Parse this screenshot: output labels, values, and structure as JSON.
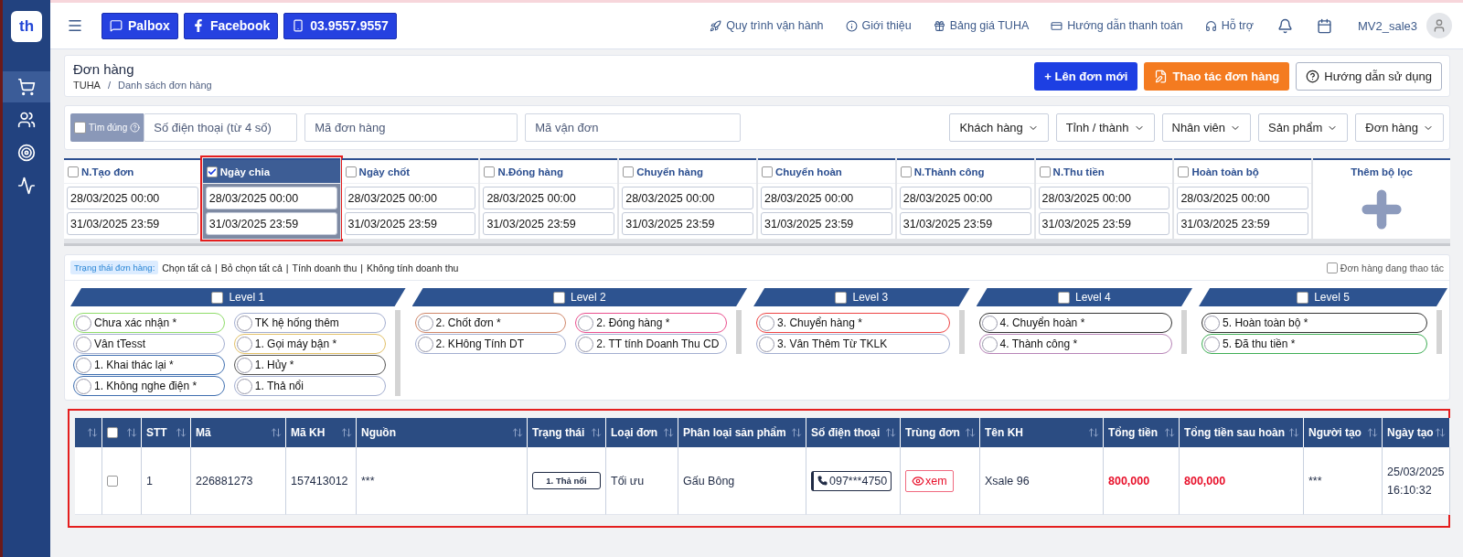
{
  "sidebar": {
    "logo": "th",
    "items": [
      {
        "kind": "cart",
        "selected": true
      },
      {
        "kind": "users",
        "selected": false
      },
      {
        "kind": "target",
        "selected": false
      },
      {
        "kind": "activity",
        "selected": false
      }
    ]
  },
  "topbar": {
    "quick_links": [
      {
        "kind": "chat",
        "label": "Palbox"
      },
      {
        "kind": "facebook",
        "label": "Facebook"
      },
      {
        "kind": "phone",
        "label": "03.9557.9557"
      }
    ],
    "nav": [
      {
        "kind": "rocket",
        "label": "Quy trình vận hành"
      },
      {
        "kind": "info",
        "label": "Giới thiệu"
      },
      {
        "kind": "gift",
        "label": "Bảng giá TUHA"
      },
      {
        "kind": "card",
        "label": "Hướng dẫn thanh toán"
      },
      {
        "kind": "headset",
        "label": "Hỗ trợ"
      }
    ],
    "user": "MV2_sale3"
  },
  "page": {
    "title": "Đơn hàng",
    "breadcrumb": [
      "TUHA",
      "Danh sách đơn hàng"
    ],
    "breadcrumb_separator": "/",
    "actions": [
      {
        "kind": "primary",
        "label": "+ Lên đơn mới"
      },
      {
        "kind": "warning",
        "label": "Thao tác đơn hàng"
      },
      {
        "kind": "help",
        "label": "Hướng dẫn sử dụng"
      }
    ]
  },
  "search": {
    "exact": {
      "label": "Tìm đúng",
      "checked": false
    },
    "fields": [
      {
        "placeholder": "Số điện thoại (từ 4 số)"
      },
      {
        "placeholder": "Mã đơn hàng"
      },
      {
        "placeholder": "Mã vận đơn"
      }
    ],
    "dropdowns": [
      "Khách hàng",
      "Tỉnh / thành",
      "Nhân viên",
      "Sản phẩm",
      "Đơn hàng"
    ]
  },
  "date_filters": [
    {
      "label": "N.Tạo đơn",
      "checked": false,
      "highlighted": false,
      "from": "28/03/2025 00:00",
      "to": "31/03/2025 23:59"
    },
    {
      "label": "Ngày chia",
      "checked": true,
      "highlighted": true,
      "from": "28/03/2025 00:00",
      "to": "31/03/2025 23:59"
    },
    {
      "label": "Ngày chốt",
      "checked": false,
      "highlighted": false,
      "from": "28/03/2025 00:00",
      "to": "31/03/2025 23:59"
    },
    {
      "label": "N.Đóng hàng",
      "checked": false,
      "highlighted": false,
      "from": "28/03/2025 00:00",
      "to": "31/03/2025 23:59"
    },
    {
      "label": "Chuyển hàng",
      "checked": false,
      "highlighted": false,
      "from": "28/03/2025 00:00",
      "to": "31/03/2025 23:59"
    },
    {
      "label": "Chuyển hoàn",
      "checked": false,
      "highlighted": false,
      "from": "28/03/2025 00:00",
      "to": "31/03/2025 23:59"
    },
    {
      "label": "N.Thành công",
      "checked": false,
      "highlighted": false,
      "from": "28/03/2025 00:00",
      "to": "31/03/2025 23:59"
    },
    {
      "label": "N.Thu tiền",
      "checked": false,
      "highlighted": false,
      "from": "28/03/2025 00:00",
      "to": "31/03/2025 23:59"
    },
    {
      "label": "Hoàn toàn bộ",
      "checked": false,
      "highlighted": false,
      "from": "28/03/2025 00:00",
      "to": "31/03/2025 23:59"
    }
  ],
  "add_filter": "Thêm bộ lọc",
  "status": {
    "tag": "Trạng thái đơn hàng:",
    "links": [
      "Chọn tất cả",
      "Bỏ chọn tất cả",
      "Tính doanh thu",
      "Không tính doanh thu"
    ],
    "link_separator": "|",
    "in_progress": {
      "label": "Đơn hàng đang thao tác",
      "checked": false
    },
    "levels": [
      {
        "label": "Level 1",
        "checked": false,
        "items": [
          {
            "label": "Chưa xác nhận *",
            "color": "#8fdc6a",
            "checked": false
          },
          {
            "label": "TK hệ hống thêm",
            "color": "#a3aed0",
            "checked": false
          },
          {
            "label": "Vân tTesst",
            "color": "#a3aed0",
            "checked": false
          },
          {
            "label": "1. Gọi máy bận *",
            "color": "#e2c067",
            "checked": false
          },
          {
            "label": "1. Khai thác lại *",
            "color": "#3f6fb0",
            "checked": false
          },
          {
            "label": "1. Hủy *",
            "color": "#555555",
            "checked": false
          },
          {
            "label": "1. Không nghe điện *",
            "color": "#3f6fb0",
            "checked": false
          },
          {
            "label": "1. Thả nổi",
            "color": "#a3aed0",
            "checked": false
          }
        ]
      },
      {
        "label": "Level 2",
        "checked": false,
        "items": [
          {
            "label": "2. Chốt đơn *",
            "color": "#d0876a",
            "checked": false
          },
          {
            "label": "2. Đóng hàng *",
            "color": "#ea4f8e",
            "checked": false
          },
          {
            "label": "2. KHông Tính DT",
            "color": "#a3aed0",
            "checked": false
          },
          {
            "label": "2. TT tính Doanh Thu CD",
            "color": "#a3aed0",
            "checked": false
          }
        ]
      },
      {
        "label": "Level 3",
        "checked": false,
        "items": [
          {
            "label": "3. Chuyển hàng *",
            "color": "#ee4444",
            "checked": false
          },
          {
            "label": "3. Vân Thêm Từ TKLK",
            "color": "#a3aed0",
            "checked": false
          }
        ]
      },
      {
        "label": "Level 4",
        "checked": false,
        "items": [
          {
            "label": "4. Chuyển hoàn *",
            "color": "#333333",
            "checked": false
          },
          {
            "label": "4. Thành công *",
            "color": "#b784b7",
            "checked": false
          }
        ]
      },
      {
        "label": "Level 5",
        "checked": false,
        "items": [
          {
            "label": "5. Hoàn toàn bộ *",
            "color": "#333333",
            "checked": false
          },
          {
            "label": "5. Đã thu tiền *",
            "color": "#3fae55",
            "checked": false
          }
        ]
      }
    ]
  },
  "table": {
    "highlighted": true,
    "select_all": false,
    "columns": [
      {
        "kind": "sort"
      },
      {
        "kind": "check"
      },
      {
        "kind": "text",
        "label": "STT"
      },
      {
        "kind": "text",
        "label": "Mã"
      },
      {
        "kind": "text",
        "label": "Mã KH"
      },
      {
        "kind": "text",
        "label": "Nguồn"
      },
      {
        "kind": "text",
        "label": "Trạng thái"
      },
      {
        "kind": "text",
        "label": "Loại đơn"
      },
      {
        "kind": "text",
        "label": "Phân loại sản phẩm"
      },
      {
        "kind": "text",
        "label": "Số điện thoại"
      },
      {
        "kind": "text",
        "label": "Trùng đơn"
      },
      {
        "kind": "text",
        "label": "Tên KH"
      },
      {
        "kind": "text",
        "label": "Tổng tiền"
      },
      {
        "kind": "text",
        "label": "Tổng tiền sau hoàn"
      },
      {
        "kind": "text",
        "label": "Người tạo"
      },
      {
        "kind": "text",
        "label": "Ngày tạo"
      }
    ],
    "rows": [
      {
        "checked": false,
        "stt": "1",
        "ma": "226881273",
        "ma_kh": "157413012",
        "nguon": "***",
        "trang_thai": "1. Thả nổi",
        "loai_don": "Tối ưu",
        "phan_loai": "Gấu Bông",
        "phone": "097***4750",
        "trung_don": "xem",
        "ten_kh": "Xsale 96",
        "tong_tien": "800,000",
        "tong_sau_hoan": "800,000",
        "nguoi_tao": "***",
        "ngay_tao": [
          "25/03/2025",
          "16:10:32"
        ]
      }
    ]
  }
}
